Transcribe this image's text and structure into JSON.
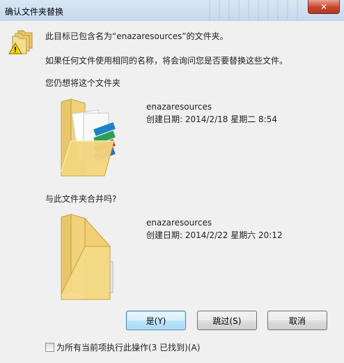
{
  "window": {
    "title": "确认文件夹替换",
    "close_label": "✕"
  },
  "dialog": {
    "message1": "此目标已包含名为“enazaresources”的文件夹。",
    "message2": "如果任何文件使用相同的名称，将会询问您是否要替换这些文件。",
    "prompt1": "您仍想将这个文件夹",
    "prompt2": "与此文件夹合并吗?",
    "existing": {
      "name": "enazaresources",
      "date": "创建日期: 2014/2/18 星期二 8:54"
    },
    "incoming": {
      "name": "enazaresources",
      "date": "创建日期: 2014/2/22 星期六 20:12"
    },
    "buttons": {
      "yes": "是(Y)",
      "skip": "跳过(S)",
      "cancel": "取消"
    },
    "checkbox_label": "为所有当前项执行此操作(3 已找到)(A)"
  },
  "icons": {
    "warning": "warning-folders-icon",
    "folder_full": "folder-with-documents-icon",
    "folder_empty": "folder-icon"
  },
  "colors": {
    "titlebar": "#c4d8ee",
    "close": "#c8452e",
    "default_button_border": "#3c7fb1"
  }
}
